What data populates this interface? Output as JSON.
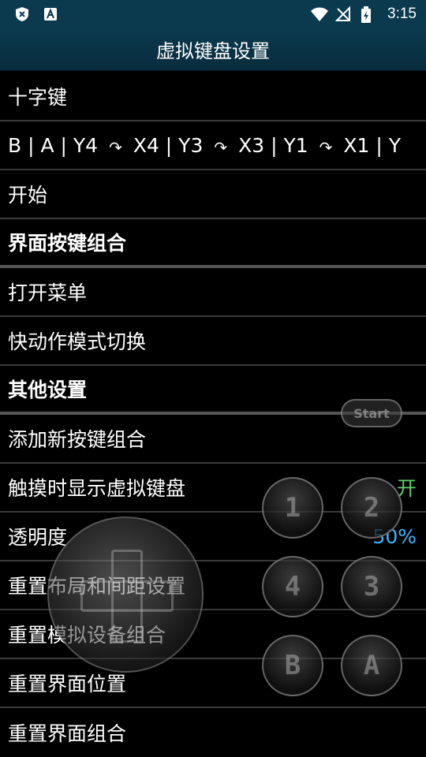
{
  "status_bar": {
    "time": "3:15",
    "left_icons": [
      "shield-x-icon",
      "font-a-icon"
    ],
    "right_icons": [
      "wifi-icon",
      "no-signal-icon",
      "battery-charging-icon"
    ]
  },
  "title": "虚拟键盘设置",
  "rows": {
    "dpad": "十字键",
    "combo": [
      "B | A | Y4",
      "X4 | Y3",
      "X3 | Y1",
      "X1 | Y"
    ],
    "start": "开始",
    "ui_combo_header": "界面按键组合",
    "open_menu": "打开菜单",
    "quick_mode": "快动作模式切换",
    "other_header": "其他设置",
    "add_combo": "添加新按键组合",
    "show_on_touch": {
      "label": "触摸时显示虚拟键盘",
      "value": "开"
    },
    "opacity": {
      "label": "透明度",
      "value": "50%"
    },
    "reset_layout": "重置布局和间距设置",
    "reset_device": "重置模拟设备组合",
    "reset_ui_pos": "重置界面位置",
    "reset_ui_combo": "重置界面组合"
  },
  "overlay": {
    "start_label": "Start",
    "buttons": [
      "1",
      "2",
      "4",
      "3",
      "B",
      "A"
    ]
  },
  "colors": {
    "statusbar": "#0b3a4f",
    "value_on": "#5fd06a",
    "value_percent": "#3ab6ff"
  }
}
